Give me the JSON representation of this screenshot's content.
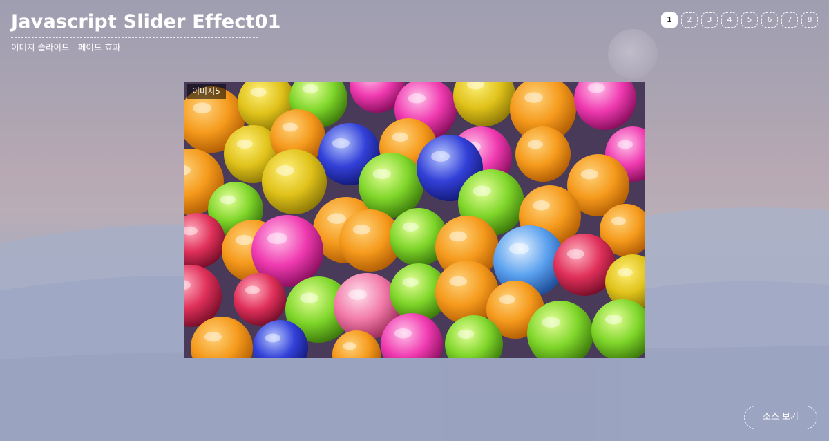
{
  "header": {
    "title": "Javascript Slider Effect01",
    "subtitle": "이미지 슬라이드 - 페이드 효과"
  },
  "pagination": {
    "items": [
      "1",
      "2",
      "3",
      "4",
      "5",
      "6",
      "7",
      "8"
    ],
    "active_index": 0
  },
  "slide": {
    "label": "이미지5",
    "image_icon": "colorful-ball-pit-image"
  },
  "footer": {
    "source_button": "소스 보기"
  },
  "colors": {
    "accent": "#ffffff",
    "label_bg": "#000000"
  }
}
